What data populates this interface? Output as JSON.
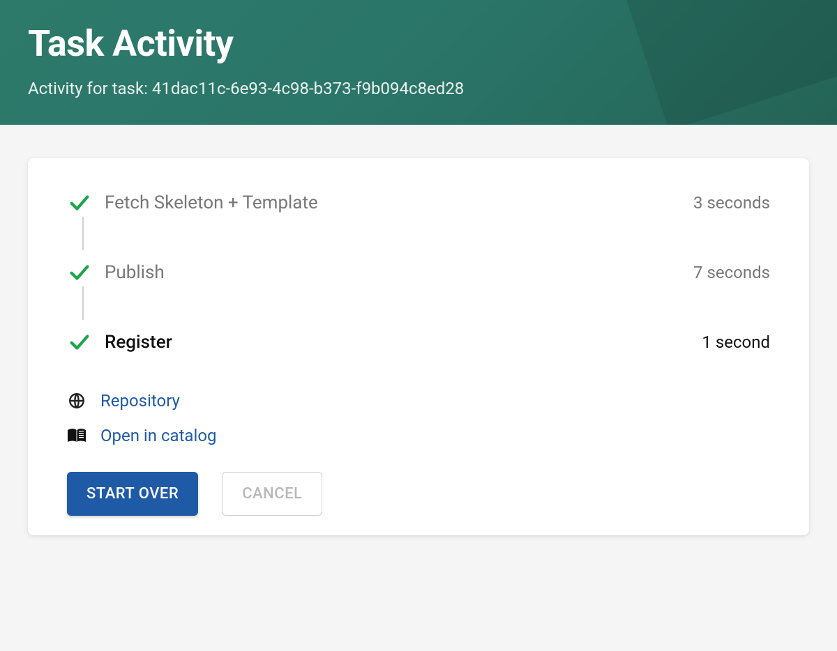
{
  "header": {
    "title": "Task Activity",
    "subtitle": "Activity for task: 41dac11c-6e93-4c98-b373-f9b094c8ed28"
  },
  "steps": [
    {
      "label": "Fetch Skeleton + Template",
      "duration": "3 seconds",
      "active": false
    },
    {
      "label": "Publish",
      "duration": "7 seconds",
      "active": false
    },
    {
      "label": "Register",
      "duration": "1 second",
      "active": true
    }
  ],
  "links": {
    "repository": "Repository",
    "catalog": "Open in catalog"
  },
  "actions": {
    "start_over": "START OVER",
    "cancel": "CANCEL"
  },
  "colors": {
    "header_bg": "#2d7a6b",
    "primary_button": "#1f5aa6",
    "link": "#1f5aa6",
    "check": "#1aa54a"
  }
}
